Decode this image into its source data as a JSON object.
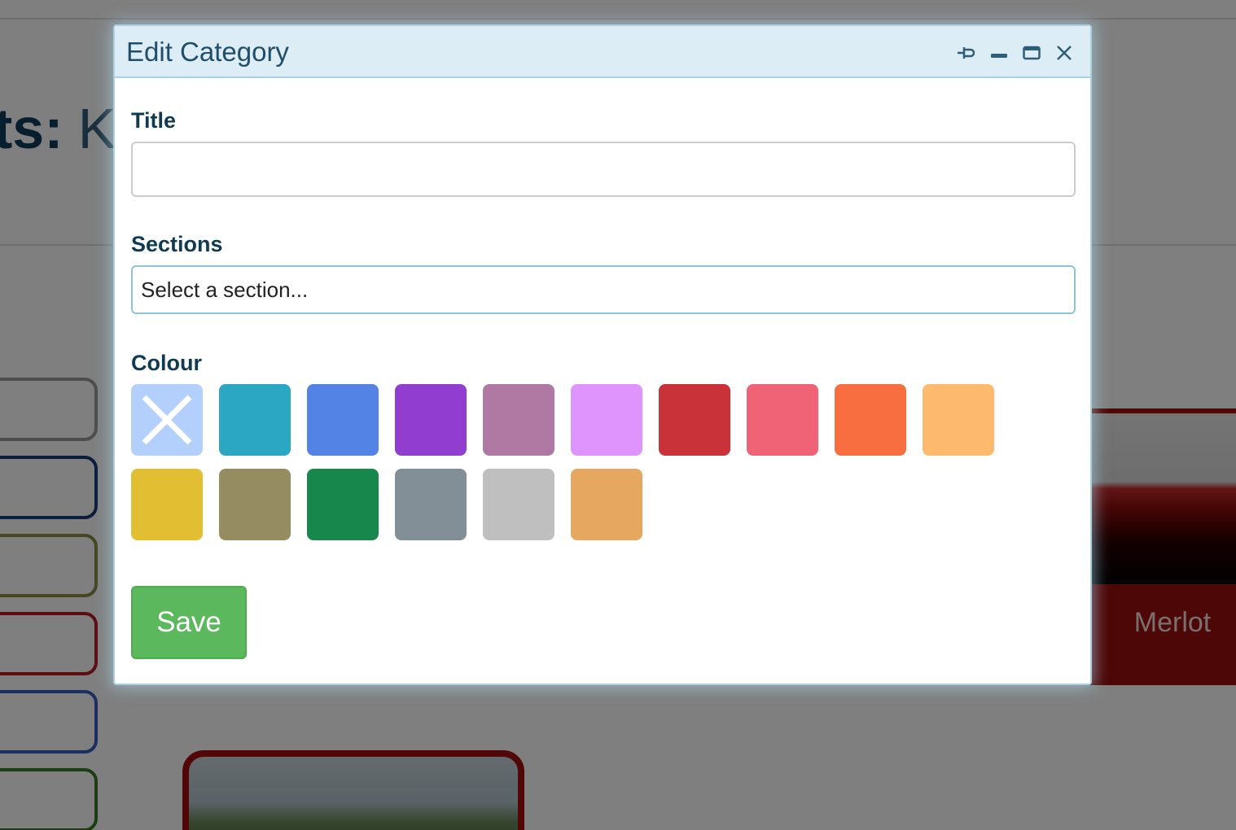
{
  "background": {
    "heading_bold": "ts:",
    "heading_light": "K",
    "merlot_label": "Merlot",
    "category_button_colors": [
      "#9a9a9a",
      "#1b3d78",
      "#8c8c46",
      "#b81d26",
      "#3b5fc2",
      "#3b7b2a"
    ]
  },
  "dialog": {
    "title": "Edit Category",
    "title_actions": [
      {
        "name": "pin-icon"
      },
      {
        "name": "minimize-icon"
      },
      {
        "name": "maximize-icon"
      },
      {
        "name": "close-icon"
      }
    ],
    "title_field": {
      "label": "Title",
      "value": "",
      "placeholder": ""
    },
    "sections_field": {
      "label": "Sections",
      "placeholder": "Select a section..."
    },
    "colour_field": {
      "label": "Colour",
      "selected": "none",
      "swatches": [
        {
          "name": "none",
          "color": "#b3cffc",
          "icon": "x-icon"
        },
        {
          "name": "teal",
          "color": "#2ba7c4"
        },
        {
          "name": "blue",
          "color": "#5483e6"
        },
        {
          "name": "purple",
          "color": "#913dd0"
        },
        {
          "name": "mauve",
          "color": "#b079a4"
        },
        {
          "name": "lilac",
          "color": "#df93fc"
        },
        {
          "name": "red",
          "color": "#c93239"
        },
        {
          "name": "pink",
          "color": "#f06276"
        },
        {
          "name": "orange",
          "color": "#f86e40"
        },
        {
          "name": "peach",
          "color": "#fdb96e"
        },
        {
          "name": "yellow",
          "color": "#e2be33"
        },
        {
          "name": "olive",
          "color": "#968c62"
        },
        {
          "name": "green",
          "color": "#18874c"
        },
        {
          "name": "slate",
          "color": "#838f97"
        },
        {
          "name": "silver",
          "color": "#bfbfbf"
        },
        {
          "name": "tan",
          "color": "#e6a861"
        }
      ]
    },
    "save_label": "Save"
  }
}
